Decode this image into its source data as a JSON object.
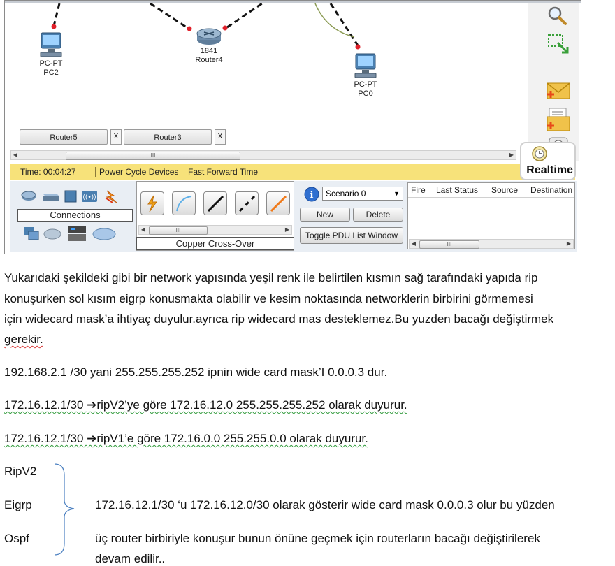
{
  "devices": {
    "pc2": {
      "model": "PC-PT",
      "name": "PC2"
    },
    "router4": {
      "model": "1841",
      "name": "Router4"
    },
    "pc0": {
      "model": "PC-PT",
      "name": "PC0"
    }
  },
  "tabs": [
    {
      "label": "Router5",
      "close": "X"
    },
    {
      "label": "Router3",
      "close": "X"
    }
  ],
  "scroll_thumb": "III",
  "status": {
    "time": "Time: 00:04:27",
    "power_cycle": "Power Cycle Devices",
    "fast_forward": "Fast Forward Time",
    "mode": "Realtime"
  },
  "bottom": {
    "category_label": "Connections",
    "connection_label": "Copper Cross-Over",
    "scenario": "Scenario 0",
    "new_button": "New",
    "delete_button": "Delete",
    "toggle_button": "Toggle PDU List Window",
    "columns": [
      "Fire",
      "Last Status",
      "Source",
      "Destination"
    ]
  },
  "text": {
    "p1_l1": "Yukarıdaki şekildeki gibi bir network yapısında yeşil renk ile belirtilen kısmın sağ tarafındaki yapıda rip",
    "p1_l2": "konuşurken sol kısım eigrp konusmakta olabilir ve kesim noktasında networklerin birbirini görmemesi",
    "p1_l3": "için widecard  mask’a ihtiyaç duyulur.ayrıca rip widecard mas desteklemez.Bu yuzden bacağı değiştirmek",
    "p1_l4": "gerekir.",
    "p2": "192.168.2.1  /30 yani 255.255.255.252  ipnin wide card mask’I 0.0.0.3 dur.",
    "p3_a": "172.16.12.1/30  ",
    "p3_arrow": "➔",
    "p3_b": "ripV2’ye göre 172.16.12.0  255.255.255.252  olarak duyurur.",
    "p4_a": "172.16.12.1/30  ",
    "p4_arrow": "➔",
    "p4_b": "ripV1’e göre 172.16.0.0  255.255.0.0  olarak duyurur.",
    "proto1": "RipV2",
    "proto2": "Eigrp",
    "proto3": "Ospf",
    "note1": "172.16.12.1/30  ‘u 172.16.12.0/30   olarak gösterir  wide card mask 0.0.0.3 olur bu yüzden",
    "note2": "üç router birbiriyle konuşur bunun önüne geçmek için routerların bacağı değiştirilerek",
    "note3": "devam edilir.."
  }
}
